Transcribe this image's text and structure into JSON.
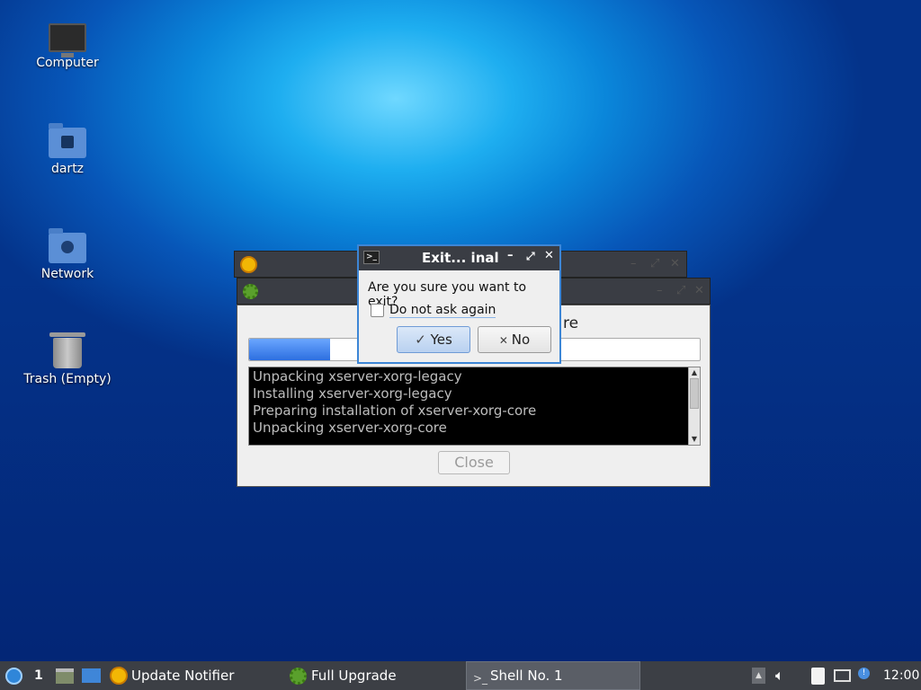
{
  "desktop": {
    "icons": [
      {
        "label": "Computer",
        "icon": "computer-icon"
      },
      {
        "label": "dartz",
        "icon": "home-folder-icon"
      },
      {
        "label": "Network",
        "icon": "network-folder-icon"
      },
      {
        "label": "Trash (Empty)",
        "icon": "trash-icon"
      }
    ]
  },
  "upgrade_window": {
    "partial_heading": "re",
    "progress": 0.18,
    "log_lines": [
      "Unpacking xserver-xorg-legacy",
      "Installing xserver-xorg-legacy",
      "Preparing installation of xserver-xorg-core",
      "Unpacking xserver-xorg-core"
    ],
    "close_label": "Close"
  },
  "dialog": {
    "title": "Exit... inal",
    "message": "Are you sure you want to exit?",
    "checkbox_label": "Do not ask again",
    "checkbox_checked": false,
    "yes_label": "Yes",
    "no_label": "No"
  },
  "taskbar": {
    "workspace": "1",
    "tasks": [
      {
        "label": "Update Notifier",
        "icon": "update-notifier-icon"
      },
      {
        "label": "Full Upgrade",
        "icon": "gear-icon"
      },
      {
        "label": "Shell No. 1",
        "icon": "terminal-icon"
      }
    ],
    "clock": "12:00"
  },
  "colors": {
    "accent": "#3d86d6",
    "taskbar_bg": "#3c3f45",
    "titlebar_bg": "#3a3d44"
  }
}
